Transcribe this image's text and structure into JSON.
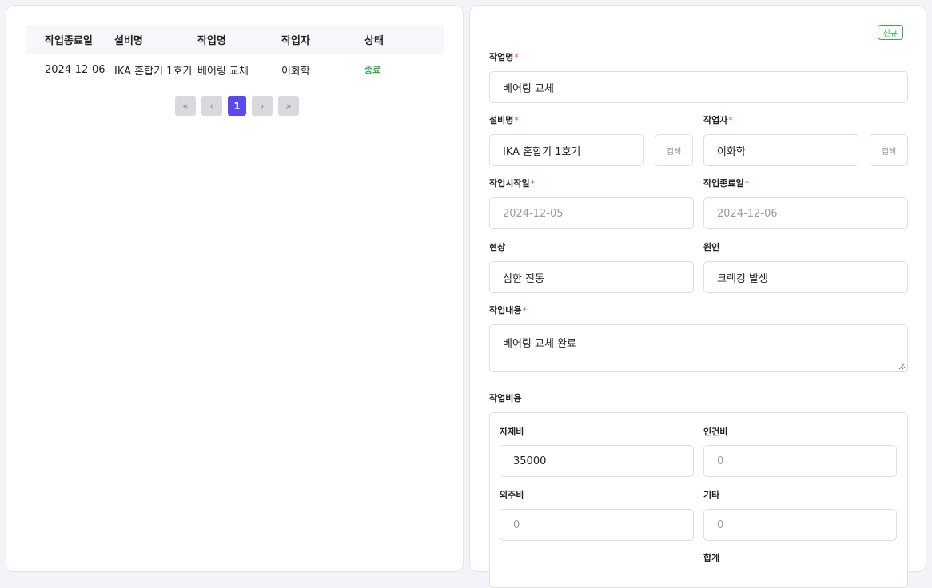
{
  "table": {
    "headers": [
      "작업종료일",
      "설비명",
      "작업명",
      "작업자",
      "상태"
    ],
    "rows": [
      {
        "end_date": "2024-12-06",
        "equipment": "IKA 혼합기 1호기",
        "task": "베어링 교체",
        "worker": "이화학",
        "status": "종료"
      }
    ]
  },
  "pagination": {
    "first": "«",
    "prev": "‹",
    "current": "1",
    "next": "›",
    "last": "»"
  },
  "form": {
    "badge": "신규",
    "required_mark": "*",
    "task_name": {
      "label": "작업명",
      "value": "베어링 교체"
    },
    "equipment": {
      "label": "설비명",
      "value": "IKA 혼합기 1호기",
      "search": "검색"
    },
    "worker": {
      "label": "작업자",
      "value": "이화학",
      "search": "검색"
    },
    "start_date": {
      "label": "작업시작일",
      "value": "2024-12-05"
    },
    "end_date": {
      "label": "작업종료일",
      "value": "2024-12-06"
    },
    "symptom": {
      "label": "현상",
      "value": "심한 진동"
    },
    "cause": {
      "label": "원인",
      "value": "크랙킹 발생"
    },
    "content": {
      "label": "작업내용",
      "value": "베어링 교체 완료"
    },
    "cost": {
      "label": "작업비용",
      "material": {
        "label": "자재비",
        "value": "35000"
      },
      "labor": {
        "label": "인건비",
        "value": "0"
      },
      "outsourcing": {
        "label": "외주비",
        "value": "0"
      },
      "other": {
        "label": "기타",
        "value": "0"
      },
      "total": {
        "label": "합계"
      }
    }
  },
  "colors": {
    "accent": "#5b49f0",
    "status_done": "#2faa4f",
    "required": "#e24a4a"
  }
}
